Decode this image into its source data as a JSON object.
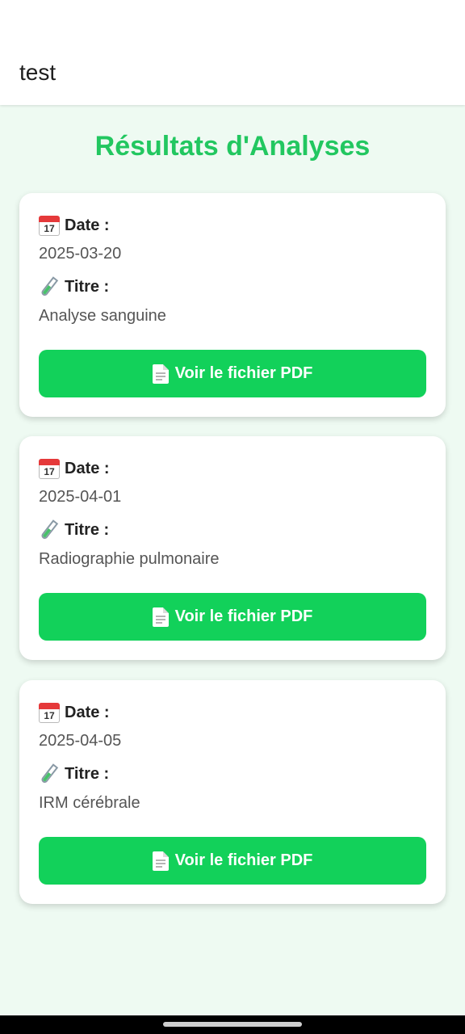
{
  "app_bar": {
    "title": "test"
  },
  "page": {
    "heading": "Résultats d'Analyses"
  },
  "labels": {
    "date": "Date :",
    "title": "Titre :",
    "button": "Voir le fichier PDF",
    "calendar_day": "17"
  },
  "results": [
    {
      "date": "2025-03-20",
      "title": "Analyse sanguine"
    },
    {
      "date": "2025-04-01",
      "title": "Radiographie pulmonaire"
    },
    {
      "date": "2025-04-05",
      "title": "IRM cérébrale"
    }
  ],
  "icons": {
    "date_icon": "calendar-icon",
    "title_icon": "test-tube-icon",
    "button_icon": "document-icon"
  },
  "colors": {
    "accent": "#22c760",
    "button": "#12d15a",
    "background": "#eefaf2"
  }
}
